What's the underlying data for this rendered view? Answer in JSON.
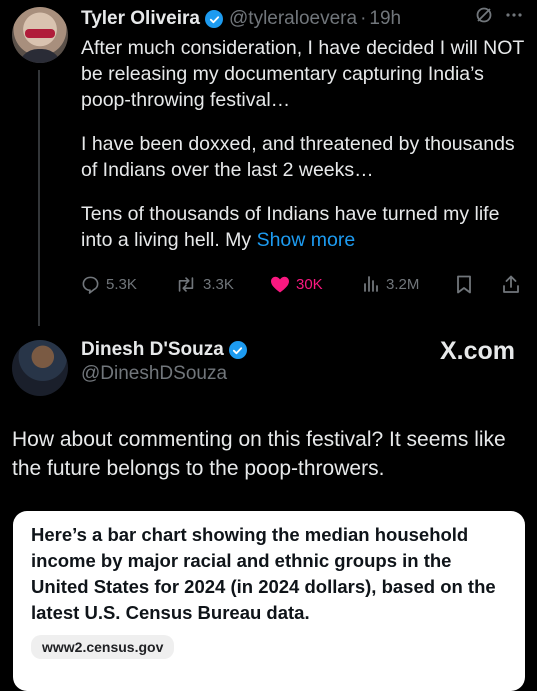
{
  "tweet1": {
    "display_name": "Tyler Oliveira",
    "handle": "@tyleraloevera",
    "separator": "·",
    "time": "19h",
    "paragraphs": [
      "After much consideration, I have decided I will NOT be releasing my documentary capturing India’s poop-throwing festival…",
      "I have been doxxed, and threatened by thousands of Indians over the last 2 weeks…",
      "Tens of thousands of Indians have turned my life into a living hell. My "
    ],
    "show_more": "Show more",
    "replies": "5.3K",
    "reposts": "3.3K",
    "likes": "30K",
    "views": "3.2M",
    "icons": [
      "grok-icon",
      "more-icon",
      "reply-icon",
      "repost-icon",
      "heart-icon",
      "views-icon",
      "bookmark-icon",
      "share-icon",
      "verified-icon"
    ]
  },
  "tweet2": {
    "display_name": "Dinesh D'Souza",
    "handle": "@DineshDSouza",
    "brand": "X.com",
    "text": "How about commenting on this festival? It seems like the future belongs to the poop-throwers."
  },
  "card": {
    "text": "Here’s a bar chart showing the median household income by major racial and ethnic groups in the United States for 2024 (in 2024 dollars), based on the latest U.S. Census Bureau data.",
    "source": "www2.census.gov"
  },
  "colors": {
    "background": "#000000",
    "text": "#e7e9ea",
    "muted": "#71767b",
    "link": "#1d9bf0",
    "like": "#f91880",
    "card_bg": "#ffffff"
  }
}
